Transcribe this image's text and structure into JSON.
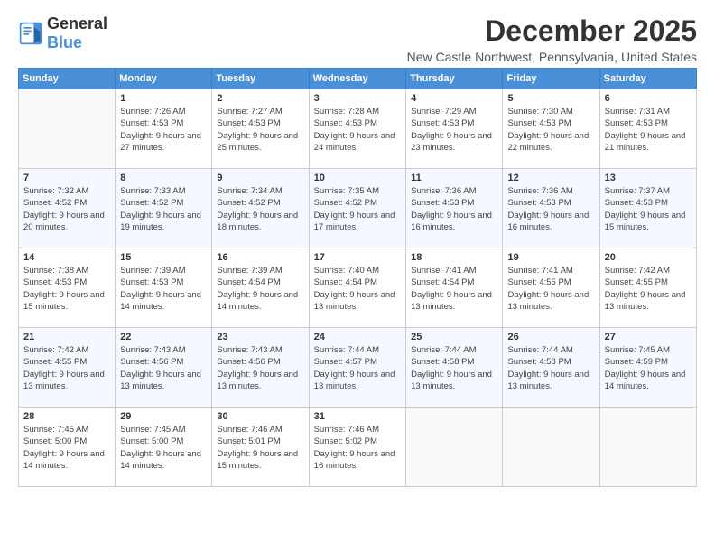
{
  "logo": {
    "general": "General",
    "blue": "Blue"
  },
  "header": {
    "month": "December 2025",
    "location": "New Castle Northwest, Pennsylvania, United States"
  },
  "weekdays": [
    "Sunday",
    "Monday",
    "Tuesday",
    "Wednesday",
    "Thursday",
    "Friday",
    "Saturday"
  ],
  "weeks": [
    [
      {
        "day": "",
        "sunrise": "",
        "sunset": "",
        "daylight": ""
      },
      {
        "day": "1",
        "sunrise": "Sunrise: 7:26 AM",
        "sunset": "Sunset: 4:53 PM",
        "daylight": "Daylight: 9 hours and 27 minutes."
      },
      {
        "day": "2",
        "sunrise": "Sunrise: 7:27 AM",
        "sunset": "Sunset: 4:53 PM",
        "daylight": "Daylight: 9 hours and 25 minutes."
      },
      {
        "day": "3",
        "sunrise": "Sunrise: 7:28 AM",
        "sunset": "Sunset: 4:53 PM",
        "daylight": "Daylight: 9 hours and 24 minutes."
      },
      {
        "day": "4",
        "sunrise": "Sunrise: 7:29 AM",
        "sunset": "Sunset: 4:53 PM",
        "daylight": "Daylight: 9 hours and 23 minutes."
      },
      {
        "day": "5",
        "sunrise": "Sunrise: 7:30 AM",
        "sunset": "Sunset: 4:53 PM",
        "daylight": "Daylight: 9 hours and 22 minutes."
      },
      {
        "day": "6",
        "sunrise": "Sunrise: 7:31 AM",
        "sunset": "Sunset: 4:53 PM",
        "daylight": "Daylight: 9 hours and 21 minutes."
      }
    ],
    [
      {
        "day": "7",
        "sunrise": "Sunrise: 7:32 AM",
        "sunset": "Sunset: 4:52 PM",
        "daylight": "Daylight: 9 hours and 20 minutes."
      },
      {
        "day": "8",
        "sunrise": "Sunrise: 7:33 AM",
        "sunset": "Sunset: 4:52 PM",
        "daylight": "Daylight: 9 hours and 19 minutes."
      },
      {
        "day": "9",
        "sunrise": "Sunrise: 7:34 AM",
        "sunset": "Sunset: 4:52 PM",
        "daylight": "Daylight: 9 hours and 18 minutes."
      },
      {
        "day": "10",
        "sunrise": "Sunrise: 7:35 AM",
        "sunset": "Sunset: 4:52 PM",
        "daylight": "Daylight: 9 hours and 17 minutes."
      },
      {
        "day": "11",
        "sunrise": "Sunrise: 7:36 AM",
        "sunset": "Sunset: 4:53 PM",
        "daylight": "Daylight: 9 hours and 16 minutes."
      },
      {
        "day": "12",
        "sunrise": "Sunrise: 7:36 AM",
        "sunset": "Sunset: 4:53 PM",
        "daylight": "Daylight: 9 hours and 16 minutes."
      },
      {
        "day": "13",
        "sunrise": "Sunrise: 7:37 AM",
        "sunset": "Sunset: 4:53 PM",
        "daylight": "Daylight: 9 hours and 15 minutes."
      }
    ],
    [
      {
        "day": "14",
        "sunrise": "Sunrise: 7:38 AM",
        "sunset": "Sunset: 4:53 PM",
        "daylight": "Daylight: 9 hours and 15 minutes."
      },
      {
        "day": "15",
        "sunrise": "Sunrise: 7:39 AM",
        "sunset": "Sunset: 4:53 PM",
        "daylight": "Daylight: 9 hours and 14 minutes."
      },
      {
        "day": "16",
        "sunrise": "Sunrise: 7:39 AM",
        "sunset": "Sunset: 4:54 PM",
        "daylight": "Daylight: 9 hours and 14 minutes."
      },
      {
        "day": "17",
        "sunrise": "Sunrise: 7:40 AM",
        "sunset": "Sunset: 4:54 PM",
        "daylight": "Daylight: 9 hours and 13 minutes."
      },
      {
        "day": "18",
        "sunrise": "Sunrise: 7:41 AM",
        "sunset": "Sunset: 4:54 PM",
        "daylight": "Daylight: 9 hours and 13 minutes."
      },
      {
        "day": "19",
        "sunrise": "Sunrise: 7:41 AM",
        "sunset": "Sunset: 4:55 PM",
        "daylight": "Daylight: 9 hours and 13 minutes."
      },
      {
        "day": "20",
        "sunrise": "Sunrise: 7:42 AM",
        "sunset": "Sunset: 4:55 PM",
        "daylight": "Daylight: 9 hours and 13 minutes."
      }
    ],
    [
      {
        "day": "21",
        "sunrise": "Sunrise: 7:42 AM",
        "sunset": "Sunset: 4:55 PM",
        "daylight": "Daylight: 9 hours and 13 minutes."
      },
      {
        "day": "22",
        "sunrise": "Sunrise: 7:43 AM",
        "sunset": "Sunset: 4:56 PM",
        "daylight": "Daylight: 9 hours and 13 minutes."
      },
      {
        "day": "23",
        "sunrise": "Sunrise: 7:43 AM",
        "sunset": "Sunset: 4:56 PM",
        "daylight": "Daylight: 9 hours and 13 minutes."
      },
      {
        "day": "24",
        "sunrise": "Sunrise: 7:44 AM",
        "sunset": "Sunset: 4:57 PM",
        "daylight": "Daylight: 9 hours and 13 minutes."
      },
      {
        "day": "25",
        "sunrise": "Sunrise: 7:44 AM",
        "sunset": "Sunset: 4:58 PM",
        "daylight": "Daylight: 9 hours and 13 minutes."
      },
      {
        "day": "26",
        "sunrise": "Sunrise: 7:44 AM",
        "sunset": "Sunset: 4:58 PM",
        "daylight": "Daylight: 9 hours and 13 minutes."
      },
      {
        "day": "27",
        "sunrise": "Sunrise: 7:45 AM",
        "sunset": "Sunset: 4:59 PM",
        "daylight": "Daylight: 9 hours and 14 minutes."
      }
    ],
    [
      {
        "day": "28",
        "sunrise": "Sunrise: 7:45 AM",
        "sunset": "Sunset: 5:00 PM",
        "daylight": "Daylight: 9 hours and 14 minutes."
      },
      {
        "day": "29",
        "sunrise": "Sunrise: 7:45 AM",
        "sunset": "Sunset: 5:00 PM",
        "daylight": "Daylight: 9 hours and 14 minutes."
      },
      {
        "day": "30",
        "sunrise": "Sunrise: 7:46 AM",
        "sunset": "Sunset: 5:01 PM",
        "daylight": "Daylight: 9 hours and 15 minutes."
      },
      {
        "day": "31",
        "sunrise": "Sunrise: 7:46 AM",
        "sunset": "Sunset: 5:02 PM",
        "daylight": "Daylight: 9 hours and 16 minutes."
      },
      {
        "day": "",
        "sunrise": "",
        "sunset": "",
        "daylight": ""
      },
      {
        "day": "",
        "sunrise": "",
        "sunset": "",
        "daylight": ""
      },
      {
        "day": "",
        "sunrise": "",
        "sunset": "",
        "daylight": ""
      }
    ]
  ]
}
